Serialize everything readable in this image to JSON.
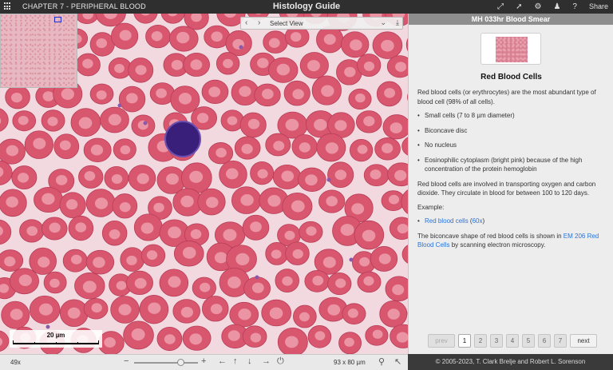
{
  "topbar": {
    "chapter": "CHAPTER 7 - PERIPHERAL BLOOD",
    "title": "Histology Guide",
    "share": "Share",
    "icons": [
      "menu-icon",
      "fullscreen-icon",
      "pointer-icon",
      "settings-icon",
      "user-icon",
      "help-icon"
    ]
  },
  "viewer": {
    "select_view": "Select View",
    "scale_label": "20 µm",
    "zoom": "49x",
    "dims": "93 x 80 µm"
  },
  "panel": {
    "header": "MH 033hr Blood Smear",
    "title": "Red Blood Cells",
    "intro": "Red blood cells (or erythrocytes) are the most abundant type of blood cell (98% of all cells).",
    "bullets": [
      "Small cells (7 to 8 µm diameter)",
      "Biconcave disc",
      "No nucleus",
      "Eosinophilic cytoplasm (bright pink) because of the high concentration of the protein hemoglobin"
    ],
    "function": "Red blood cells are involved in transporting oxygen and carbon dioxide. They circulate in blood for between 100 to 120 days.",
    "example_label": "Example:",
    "example_link": "Red blood cells",
    "example_mag_open": " (",
    "example_mag": "60x",
    "example_mag_close": ")",
    "em_text_before": "The biconcave shape of red blood cells is shown in ",
    "em_link": "EM 206 Red Blood Cells",
    "em_text_after": " by scanning electron microscopy."
  },
  "pager": {
    "prev": "prev",
    "pages": [
      "1",
      "2",
      "3",
      "4",
      "5",
      "6",
      "7"
    ],
    "active": "1",
    "next": "next"
  },
  "footer": "© 2005-2023, T. Clark Brelje and Robert L. Sorenson",
  "colors": {
    "rbc": "#d9566f",
    "rbc_center": "#f0a9b6",
    "background": "#f1d9df",
    "lymphocyte": "#3a1f7a",
    "link": "#2a73d9"
  }
}
